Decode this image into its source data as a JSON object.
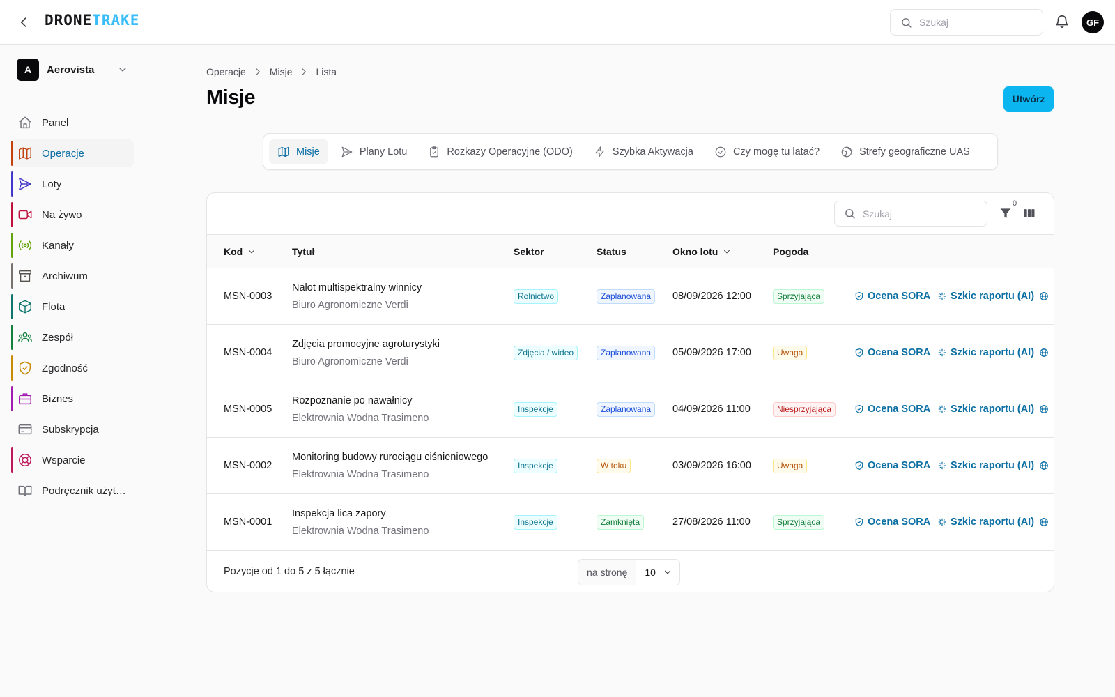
{
  "app": {
    "logo_part1": "DRONE",
    "logo_part2": "TRAKE",
    "search_placeholder": "Szukaj",
    "user_initials": "GF"
  },
  "org": {
    "initial": "A",
    "name": "Aerovista"
  },
  "sidebar": {
    "items": [
      {
        "key": "panel",
        "label": "Panel",
        "icon": "home-icon",
        "bar": ""
      },
      {
        "key": "operacje",
        "label": "Operacje",
        "icon": "map-icon",
        "bar": "#c2410c"
      },
      {
        "key": "loty",
        "label": "Loty",
        "icon": "send-icon",
        "bar": "#4338ca"
      },
      {
        "key": "na-zywo",
        "label": "Na żywo",
        "icon": "video-icon",
        "bar": "#be123c"
      },
      {
        "key": "kanaly",
        "label": "Kanały",
        "icon": "broadcast-icon",
        "bar": "#65a30d"
      },
      {
        "key": "archiwum",
        "label": "Archiwum",
        "icon": "archive-icon",
        "bar": "#78716c"
      },
      {
        "key": "flota",
        "label": "Flota",
        "icon": "box-icon",
        "bar": "#0f766e"
      },
      {
        "key": "zespol",
        "label": "Zespół",
        "icon": "users-icon",
        "bar": "#15803d"
      },
      {
        "key": "zgodnosc",
        "label": "Zgodność",
        "icon": "shield-check-icon",
        "bar": "#ca8a04"
      },
      {
        "key": "biznes",
        "label": "Biznes",
        "icon": "briefcase-icon",
        "bar": "#a21caf"
      },
      {
        "key": "subskrypcja",
        "label": "Subskrypcja",
        "icon": "credit-card-icon",
        "bar": ""
      },
      {
        "key": "wsparcie",
        "label": "Wsparcie",
        "icon": "lifebuoy-icon",
        "bar": "#be185d"
      },
      {
        "key": "podrecznik",
        "label": "Podręcznik użytkownika",
        "icon": "book-icon",
        "bar": ""
      }
    ]
  },
  "breadcrumb": [
    "Operacje",
    "Misje",
    "Lista"
  ],
  "page": {
    "title": "Misje",
    "create_label": "Utwórz"
  },
  "tabs": [
    {
      "label": "Misje",
      "icon": "map-icon"
    },
    {
      "label": "Plany Lotu",
      "icon": "send-icon"
    },
    {
      "label": "Rozkazy Operacyjne (ODO)",
      "icon": "clipboard-icon"
    },
    {
      "label": "Szybka Aktywacja",
      "icon": "zap-icon"
    },
    {
      "label": "Czy mogę tu latać?",
      "icon": "check-circle-icon"
    },
    {
      "label": "Strefy geograficzne UAS",
      "icon": "globe-icon"
    }
  ],
  "table": {
    "search_placeholder": "Szukaj",
    "filter_count": "0",
    "columns": {
      "code": "Kod",
      "title": "Tytuł",
      "sector": "Sektor",
      "status": "Status",
      "window": "Okno lotu",
      "weather": "Pogoda"
    },
    "action_sora": "Ocena SORA",
    "action_report": "Szkic raportu (AI)",
    "rows": [
      {
        "code": "MSN-0003",
        "title": "Nalot multispektralny winnicy",
        "client": "Biuro Agronomiczne Verdi",
        "sector": "Rolnictwo",
        "status": "Zaplanowana",
        "window": "08/09/2026 12:00",
        "weather": "Sprzyjająca"
      },
      {
        "code": "MSN-0004",
        "title": "Zdjęcia promocyjne agroturystyki",
        "client": "Biuro Agronomiczne Verdi",
        "sector": "Zdjęcia / wideo",
        "status": "Zaplanowana",
        "window": "05/09/2026 17:00",
        "weather": "Uwaga"
      },
      {
        "code": "MSN-0005",
        "title": "Rozpoznanie po nawałnicy",
        "client": "Elektrownia Wodna Trasimeno",
        "sector": "Inspekcje",
        "status": "Zaplanowana",
        "window": "04/09/2026 11:00",
        "weather": "Niesprzyjająca"
      },
      {
        "code": "MSN-0002",
        "title": "Monitoring budowy rurociągu ciśnieniowego",
        "client": "Elektrownia Wodna Trasimeno",
        "sector": "Inspekcje",
        "status": "W toku",
        "window": "03/09/2026 16:00",
        "weather": "Uwaga"
      },
      {
        "code": "MSN-0001",
        "title": "Inspekcja lica zapory",
        "client": "Elektrownia Wodna Trasimeno",
        "sector": "Inspekcje",
        "status": "Zamknięta",
        "window": "27/08/2026 11:00",
        "weather": "Sprzyjająca"
      }
    ],
    "footer_text": "Pozycje od 1 do 5 z 5 łącznie",
    "per_page_label": "na stronę",
    "per_page_value": "10"
  }
}
